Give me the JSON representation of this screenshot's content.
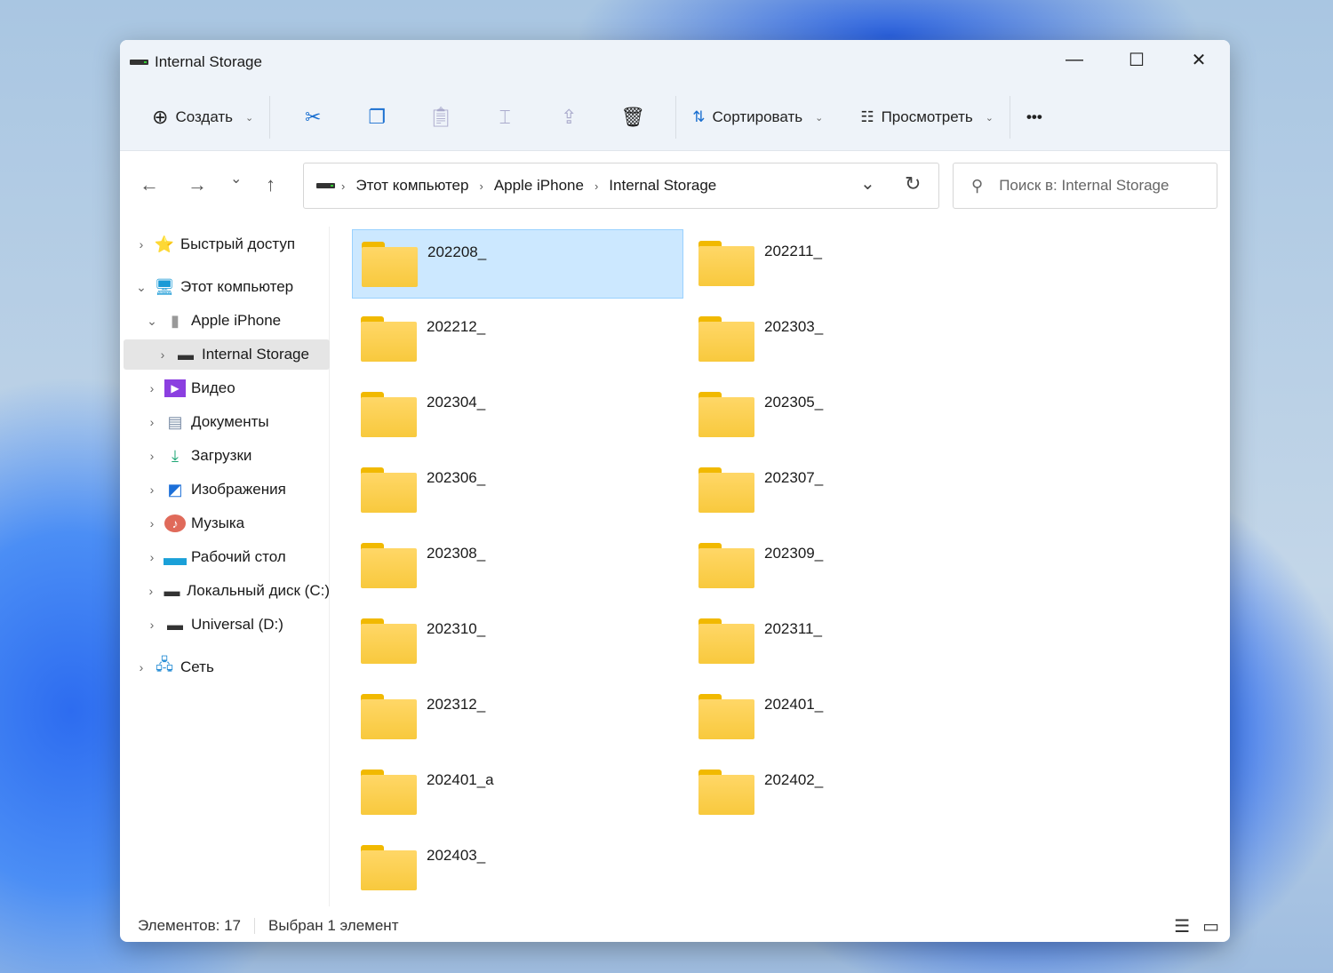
{
  "window": {
    "title": "Internal Storage",
    "minimize": "—",
    "maximize": "☐",
    "close": "✕"
  },
  "toolbar": {
    "create": "Создать",
    "sort": "Сортировать",
    "view": "Просмотреть",
    "more": "•••"
  },
  "nav": {
    "back": "←",
    "forward": "→",
    "recent": "⌄",
    "up": "↑",
    "refresh": "↻",
    "dropdown": "⌄"
  },
  "breadcrumb": [
    "Этот компьютер",
    "Apple iPhone",
    "Internal Storage"
  ],
  "search": {
    "placeholder": "Поиск в: Internal Storage"
  },
  "sidebar": [
    {
      "label": "Быстрый доступ",
      "icon": "star"
    },
    {
      "label": "Этот компьютер",
      "icon": "monitor"
    },
    {
      "label": "Apple iPhone",
      "icon": "phone"
    },
    {
      "label": "Internal Storage",
      "icon": "drive"
    },
    {
      "label": "Видео",
      "icon": "video"
    },
    {
      "label": "Документы",
      "icon": "documents"
    },
    {
      "label": "Загрузки",
      "icon": "download"
    },
    {
      "label": "Изображения",
      "icon": "pictures"
    },
    {
      "label": "Музыка",
      "icon": "music"
    },
    {
      "label": "Рабочий стол",
      "icon": "desktop"
    },
    {
      "label": "Локальный диск (C:)",
      "icon": "drive"
    },
    {
      "label": "Universal (D:)",
      "icon": "drive"
    },
    {
      "label": "Сеть",
      "icon": "network"
    }
  ],
  "folders": [
    "202208_",
    "202211_",
    "202212_",
    "202303_",
    "202304_",
    "202305_",
    "202306_",
    "202307_",
    "202308_",
    "202309_",
    "202310_",
    "202311_",
    "202312_",
    "202401_",
    "202401_a",
    "202402_",
    "202403_"
  ],
  "status": {
    "count": "Элементов: 17",
    "selected": "Выбран 1 элемент"
  }
}
